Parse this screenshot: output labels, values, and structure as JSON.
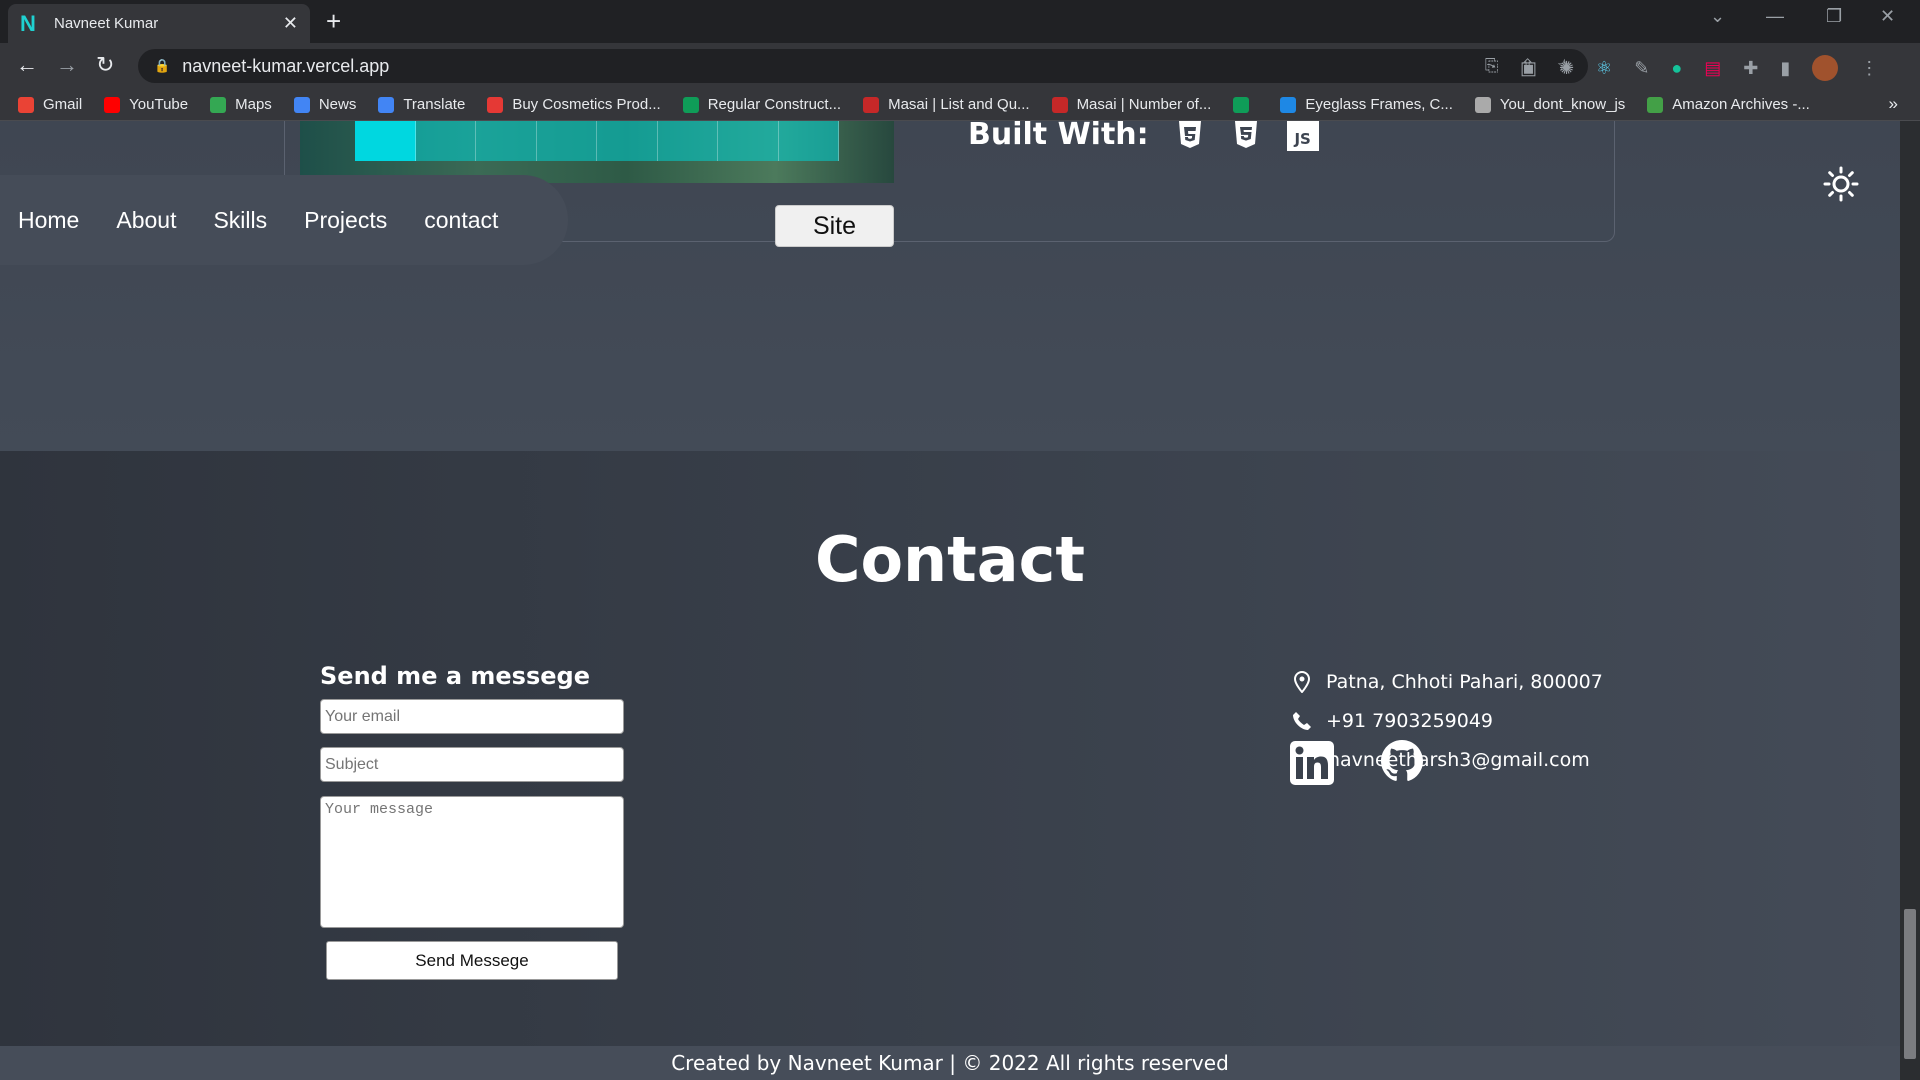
{
  "browser": {
    "tab_title": "Navneet Kumar",
    "tab_favicon": "N",
    "url": "navneet-kumar.vercel.app",
    "bookmarks": [
      {
        "label": "Gmail",
        "color": "#ea4335"
      },
      {
        "label": "YouTube",
        "color": "#ff0000"
      },
      {
        "label": "Maps",
        "color": "#34a853"
      },
      {
        "label": "News",
        "color": "#4285f4"
      },
      {
        "label": "Translate",
        "color": "#4285f4"
      },
      {
        "label": "Buy Cosmetics Prod...",
        "color": "#e53935"
      },
      {
        "label": "Regular Construct...",
        "color": "#0f9d58"
      },
      {
        "label": "Masai | List and Qu...",
        "color": "#c62828"
      },
      {
        "label": "Masai | Number of...",
        "color": "#c62828"
      },
      {
        "label": "",
        "color": "#0f9d58"
      },
      {
        "label": "Eyeglass Frames, C...",
        "color": "#1e88e5"
      },
      {
        "label": "You_dont_know_js",
        "color": "#aaaaaa"
      },
      {
        "label": "Amazon Archives -...",
        "color": "#43a047"
      }
    ],
    "more": "»"
  },
  "project": {
    "built_with_label": "Built With:",
    "tech_icons": [
      "html5-icon",
      "css3-icon",
      "js-icon"
    ],
    "js_label": "JS",
    "site_button": "Site"
  },
  "nav": {
    "items": [
      "Home",
      "About",
      "Skills",
      "Projects",
      "contact"
    ]
  },
  "contact": {
    "title": "Contact",
    "form_heading": "Send me a messege",
    "email_placeholder": "Your email",
    "subject_placeholder": "Subject",
    "message_placeholder": "Your message",
    "send_button": "Send Messege",
    "address": "Patna, Chhoti Pahari, 800007",
    "phone": "+91 7903259049",
    "email": "navneetharsh3@gmail.com"
  },
  "footer": {
    "text": "Created by Navneet Kumar | © 2022 All rights reserved"
  }
}
